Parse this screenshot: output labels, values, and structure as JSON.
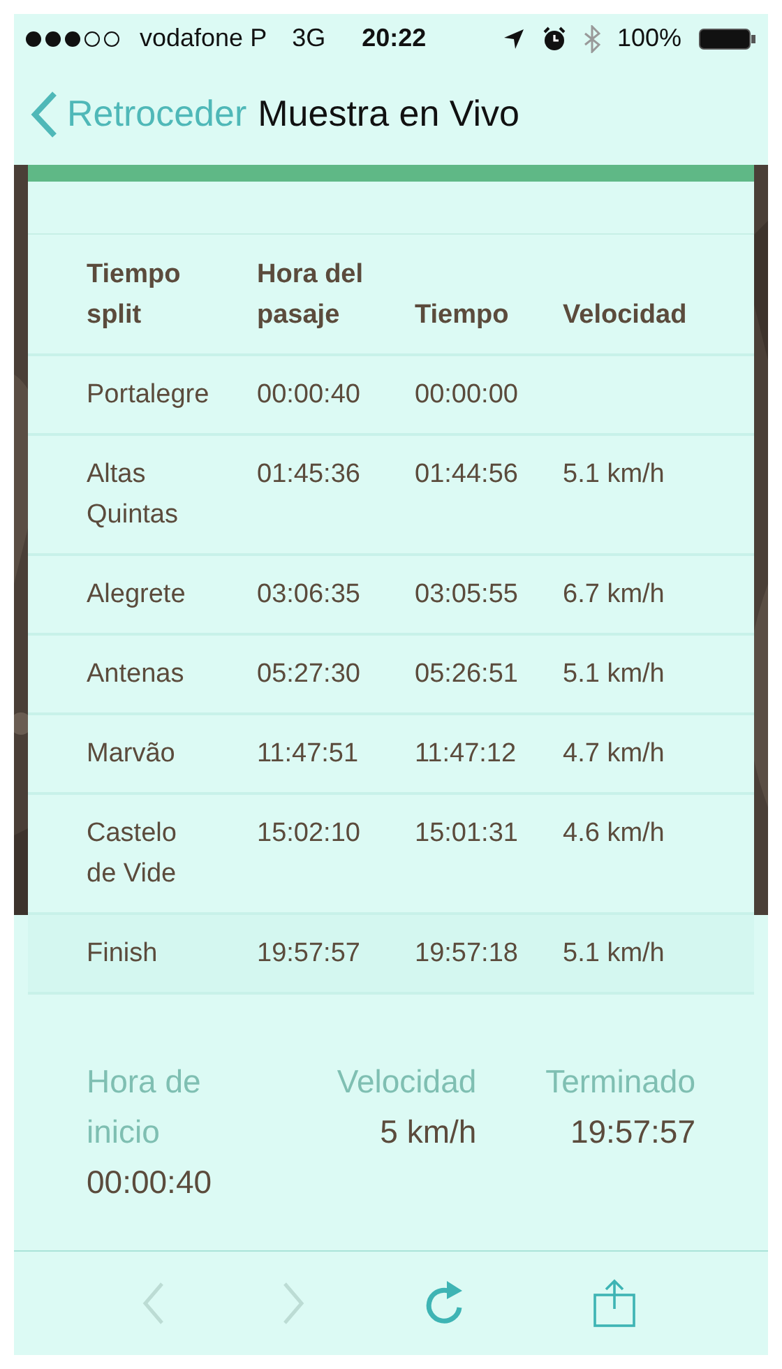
{
  "status_bar": {
    "carrier": "vodafone P",
    "network": "3G",
    "time": "20:22",
    "battery": "100%"
  },
  "nav": {
    "back_label": "Retroceder",
    "title": "Muestra en Vivo"
  },
  "table": {
    "columns": [
      "Tiempo split",
      "Hora del pasaje",
      "Tiempo",
      "Velocidad"
    ],
    "rows": [
      [
        "Portalegre",
        "00:00:40",
        "00:00:00",
        ""
      ],
      [
        "Altas Quintas",
        "01:45:36",
        "01:44:56",
        "5.1 km/h"
      ],
      [
        "Alegrete",
        "03:06:35",
        "03:05:55",
        "6.7 km/h"
      ],
      [
        "Antenas",
        "05:27:30",
        "05:26:51",
        "5.1 km/h"
      ],
      [
        "Marvão",
        "11:47:51",
        "11:47:12",
        "4.7 km/h"
      ],
      [
        "Castelo de Vide",
        "15:02:10",
        "15:01:31",
        "4.6 km/h"
      ],
      [
        "Finish",
        "19:57:57",
        "19:57:18",
        "5.1 km/h"
      ]
    ]
  },
  "summary": [
    {
      "label": "Hora de inicio",
      "value": "00:00:40"
    },
    {
      "label": "Velocidad",
      "value": "5 km/h"
    },
    {
      "label": "Terminado",
      "value": "19:57:57"
    }
  ],
  "toolbar": [
    {
      "kind": "back",
      "disabled": true
    },
    {
      "kind": "forward",
      "disabled": true
    },
    {
      "kind": "reload",
      "disabled": false
    },
    {
      "kind": "share",
      "disabled": false
    }
  ]
}
